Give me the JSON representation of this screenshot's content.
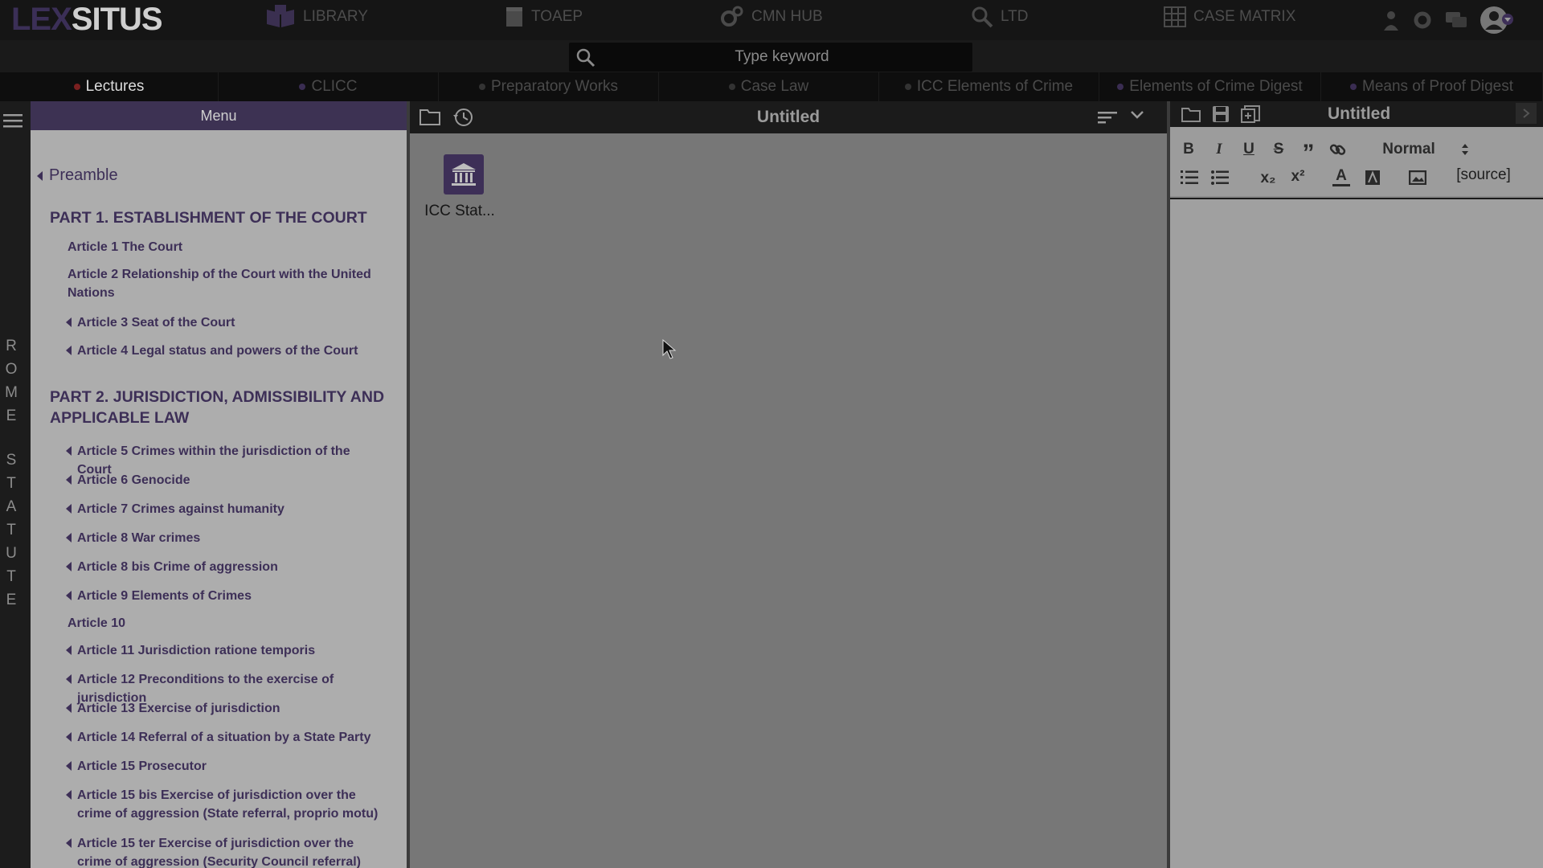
{
  "app": {
    "logo_a": "LEX",
    "logo_b": "SITUS"
  },
  "topnav": {
    "library": "LIBRARY",
    "toaep": "TOAEP",
    "cmn_hub": "CMN HUB",
    "ltd": "LTD",
    "case_matrix": "CASE MATRIX"
  },
  "search": {
    "placeholder": "Type keyword"
  },
  "tabs": [
    {
      "label": "Lectures"
    },
    {
      "label": "CLICC"
    },
    {
      "label": "Preparatory Works"
    },
    {
      "label": "Case Law"
    },
    {
      "label": "ICC Elements of Crime"
    },
    {
      "label": "Elements of Crime Digest"
    },
    {
      "label": "Means of Proof Digest"
    }
  ],
  "rail": {
    "letters": [
      "R",
      "O",
      "M",
      "E",
      "S",
      "T",
      "A",
      "T",
      "U",
      "T",
      "E"
    ]
  },
  "menu": {
    "title": "Menu",
    "preamble": "Preamble",
    "part1": "PART 1. ESTABLISHMENT OF THE COURT",
    "part2": "PART 2. JURISDICTION, ADMISSIBILITY AND APPLICABLE LAW",
    "articles": [
      "Article 1 The Court",
      "Article 2 Relationship of the Court with the United Nations",
      "Article 3 Seat of the Court",
      "Article 4 Legal status and powers of the Court",
      "Article 5 Crimes within the jurisdiction of the Court",
      "Article 6 Genocide",
      "Article 7 Crimes against humanity",
      "Article 8 War crimes",
      "Article 8 bis Crime of aggression",
      "Article 9 Elements of Crimes",
      "Article 10",
      "Article 11 Jurisdiction ratione temporis",
      "Article 12 Preconditions to the exercise of jurisdiction",
      "Article 13 Exercise of jurisdiction",
      "Article 14 Referral of a situation by a State Party",
      "Article 15 Prosecutor",
      "Article 15 bis Exercise of jurisdiction over the crime of aggression (State referral, proprio motu)",
      "Article 15 ter Exercise of jurisdiction over the crime of aggression (Security Council referral)"
    ]
  },
  "workspace": {
    "title": "Untitled",
    "file_name": "ICC Stat..."
  },
  "editor": {
    "title": "Untitled",
    "format": "Normal",
    "source": "[source]",
    "bold": "B",
    "italic": "I",
    "underline": "U",
    "strike": "S",
    "quote": "”",
    "sub": "x₂",
    "sup": "x²",
    "color": "A"
  }
}
